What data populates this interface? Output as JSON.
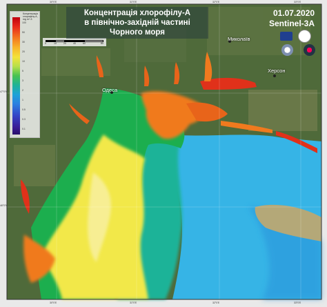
{
  "map": {
    "title_line1": "Концентрація хлорофілу-А",
    "title_line2": "в північно-західній частині Чорного моря",
    "date": "01.07.2020",
    "satellite": "Sentinel-3A",
    "colors": {
      "land": "#4f6a3a",
      "deep_sea": "#36b4e6",
      "mid_sea": "#1fb398",
      "shelf": "#1cae4e",
      "yellow": "#f2e84a",
      "orange": "#f07a1e",
      "red": "#e0311a"
    }
  },
  "legend": {
    "title": "Концентрація хлорофілу-А, mg m^-3",
    "ticks": [
      "100",
      "50",
      "30",
      "20",
      "10",
      "5",
      "3",
      "2",
      "1",
      "0.5",
      "0.3",
      "0.1"
    ]
  },
  "scale": {
    "labels": [
      "0",
      "10",
      "20",
      "40",
      "60",
      "80"
    ]
  },
  "places": {
    "odesa": "Одеса",
    "mykolaiv": "Миколаїв",
    "kherson": "Херсон"
  },
  "logos": {
    "eu": "eu-flag-logo",
    "agency": "agency-logo",
    "copernicus": "copernicus-logo",
    "esa": "ui-logo"
  },
  "coords": {
    "top": [
      "30°0'E",
      "31°0'E",
      "32°0'E",
      "33°0'E"
    ],
    "bottom": [
      "30°0'E",
      "31°0'E",
      "32°0'E",
      "33°0'E"
    ],
    "left": [
      "47°0'N",
      "46°0'N"
    ]
  }
}
